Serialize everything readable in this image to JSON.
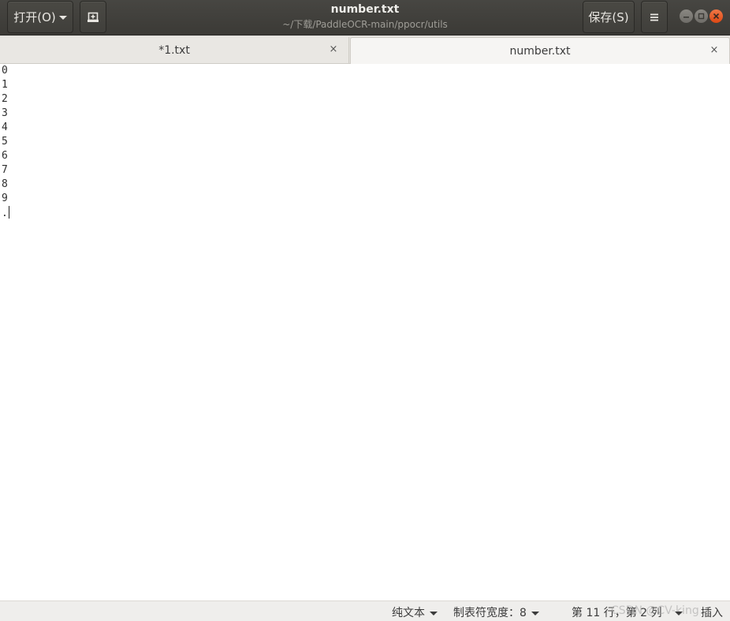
{
  "window": {
    "title": "number.txt",
    "subtitle": "~/下载/PaddleOCR-main/ppocr/utils"
  },
  "header": {
    "open_label": "打开(O)",
    "save_label": "保存(S)",
    "new_doc_icon": "new-document-icon",
    "menu_icon": "hamburger-menu-icon"
  },
  "tabs": [
    {
      "label": "*1.txt",
      "active": false,
      "close": "×"
    },
    {
      "label": "number.txt",
      "active": true,
      "close": "×"
    }
  ],
  "editor": {
    "lines": [
      "0",
      "1",
      "2",
      "3",
      "4",
      "5",
      "6",
      "7",
      "8",
      "9",
      "."
    ]
  },
  "statusbar": {
    "language": "纯文本",
    "tab_width": "制表符宽度：8",
    "position": "第 11 行，第 2 列",
    "insert_mode": "插入",
    "watermark": "CSDN @CV-king"
  },
  "colors": {
    "headerbar": "#3f3e3a",
    "close_button": "#e95420",
    "tabbar": "#e4e2de",
    "statusbar": "#efeeec"
  }
}
